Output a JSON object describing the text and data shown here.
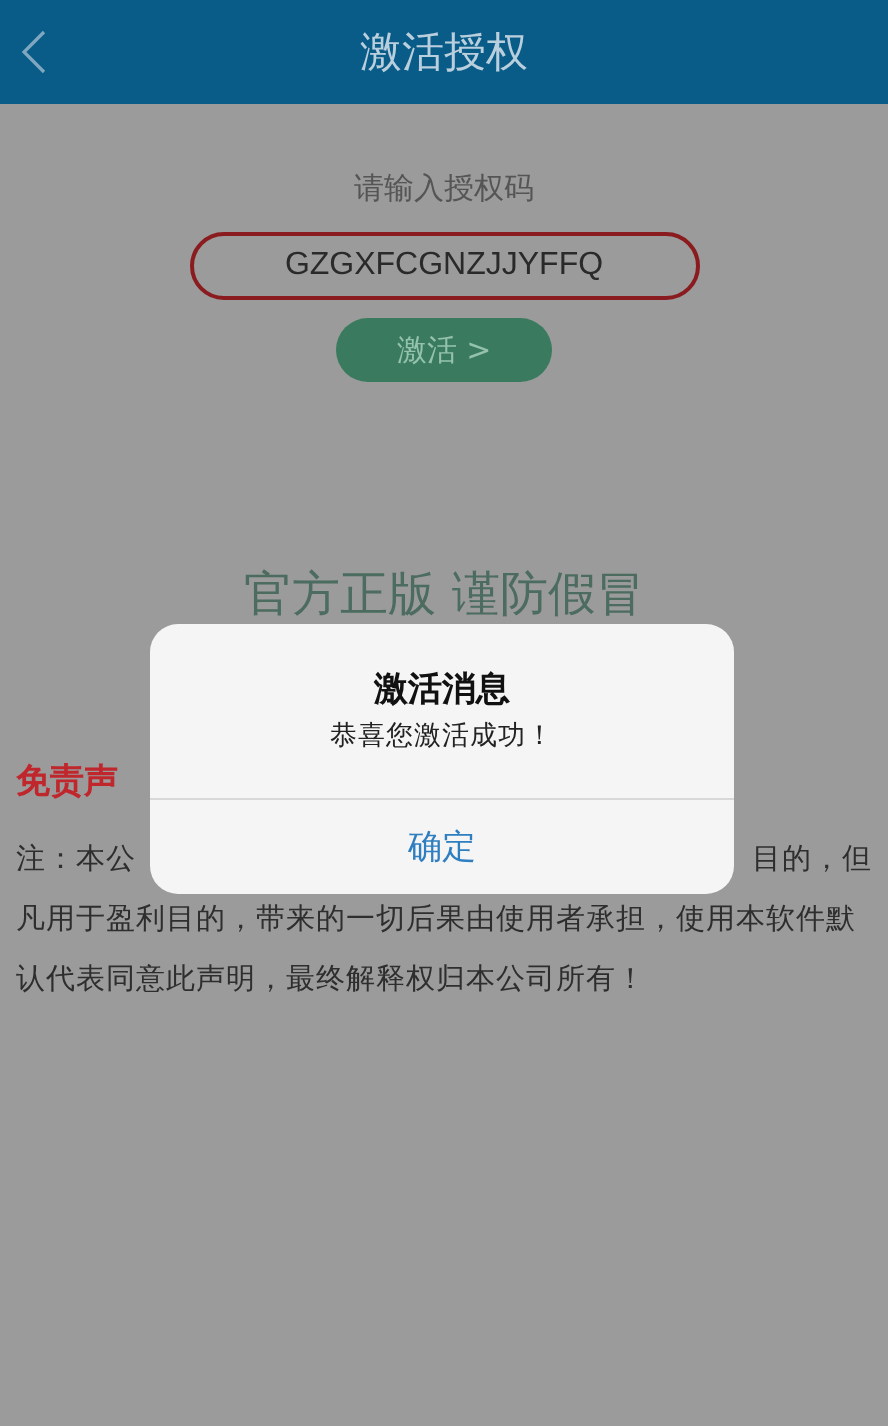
{
  "header": {
    "title": "激活授权"
  },
  "prompt": "请输入授权码",
  "code_field": {
    "value": "GZGXFCGNZJJYFFQ"
  },
  "activate_button": "激活 >",
  "slogan": "官方正版 谨防假冒",
  "disclaimer": {
    "heading": "免责声",
    "first_line_left": "注：本公",
    "first_line_right": "目的，但",
    "lines": [
      "凡用于盈利目的，带来的一切后果由使用者承担，使用本软件默",
      "认代表同意此声明，最终解释权归本公司所有！"
    ]
  },
  "dialog": {
    "title": "激活消息",
    "message": "恭喜您激活成功！",
    "button": "确定"
  }
}
